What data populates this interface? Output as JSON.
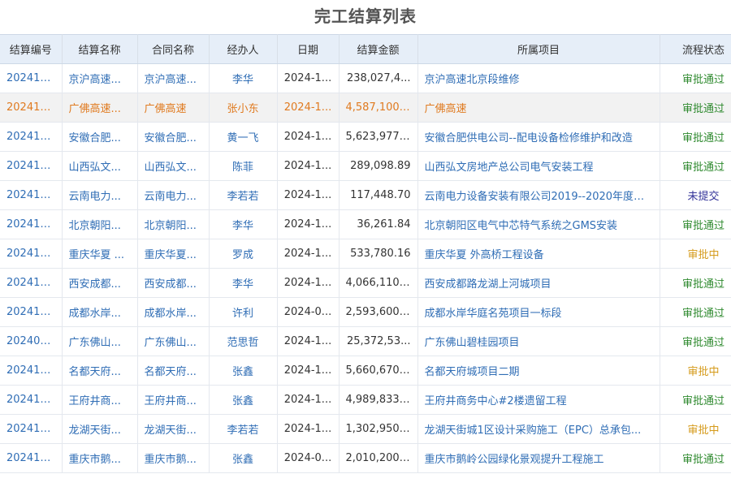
{
  "page_title": "完工结算列表",
  "colors": {
    "header_bg": "#e6eef8",
    "link": "#2f6db5",
    "selected_row_text": "#e07a1f",
    "status_approved": "#2f8a2f",
    "status_pending": "#d59a1a",
    "status_draft": "#333399"
  },
  "columns": [
    "结算编号",
    "结算名称",
    "合同名称",
    "经办人",
    "日期",
    "结算金额",
    "所属项目",
    "流程状态"
  ],
  "rows": [
    {
      "code": "202412...",
      "name": "京沪高速...",
      "contract": "京沪高速...",
      "handler": "李华",
      "date": "2024-1...",
      "amount": "238,027,4...",
      "project": "京沪高速北京段维修",
      "status": "审批通过",
      "status_type": "approved",
      "selected": false
    },
    {
      "code": "202412...",
      "name": "广佛高速...",
      "contract": "广佛高速",
      "handler": "张小东",
      "date": "2024-1...",
      "amount": "4,587,100.00",
      "project": "广佛高速",
      "status": "审批通过",
      "status_type": "approved",
      "selected": true
    },
    {
      "code": "202411...",
      "name": "安徽合肥...",
      "contract": "安徽合肥...",
      "handler": "黄一飞",
      "date": "2024-1...",
      "amount": "5,623,977.00",
      "project": "安徽合肥供电公司--配电设备检修维护和改造",
      "status": "审批通过",
      "status_type": "approved",
      "selected": false
    },
    {
      "code": "202412...",
      "name": "山西弘文...",
      "contract": "山西弘文...",
      "handler": "陈菲",
      "date": "2024-1...",
      "amount": "289,098.89",
      "project": "山西弘文房地产总公司电气安装工程",
      "status": "审批通过",
      "status_type": "approved",
      "selected": false
    },
    {
      "code": "202411...",
      "name": "云南电力...",
      "contract": "云南电力...",
      "handler": "李若若",
      "date": "2024-1...",
      "amount": "117,448.70",
      "project": "云南电力设备安装有限公司2019--2020年度劳...",
      "status": "未提交",
      "status_type": "draft",
      "selected": false
    },
    {
      "code": "202411...",
      "name": "北京朝阳...",
      "contract": "北京朝阳...",
      "handler": "李华",
      "date": "2024-1...",
      "amount": "36,261.84",
      "project": "北京朝阳区电气中芯特气系统之GMS安装",
      "status": "审批通过",
      "status_type": "approved",
      "selected": false
    },
    {
      "code": "202411...",
      "name": "重庆华夏 ...",
      "contract": "重庆华夏...",
      "handler": "罗成",
      "date": "2024-1...",
      "amount": "533,780.16",
      "project": "重庆华夏 外高桥工程设备",
      "status": "审批中",
      "status_type": "pending",
      "selected": false
    },
    {
      "code": "202410...",
      "name": "西安成都...",
      "contract": "西安成都...",
      "handler": "李华",
      "date": "2024-1...",
      "amount": "4,066,110.00",
      "project": "西安成都路龙湖上河城项目",
      "status": "审批通过",
      "status_type": "approved",
      "selected": false
    },
    {
      "code": "202410...",
      "name": "成都水岸...",
      "contract": "成都水岸...",
      "handler": "许利",
      "date": "2024-0...",
      "amount": "2,593,600.00",
      "project": "成都水岸华庭名苑项目一标段",
      "status": "审批通过",
      "status_type": "approved",
      "selected": false
    },
    {
      "code": "202409...",
      "name": "广东佛山...",
      "contract": "广东佛山...",
      "handler": "范思哲",
      "date": "2024-1...",
      "amount": "25,372,53...",
      "project": "广东佛山碧桂园项目",
      "status": "审批通过",
      "status_type": "approved",
      "selected": false
    },
    {
      "code": "202411...",
      "name": "名都天府...",
      "contract": "名都天府...",
      "handler": "张鑫",
      "date": "2024-1...",
      "amount": "5,660,670.00",
      "project": "名都天府城项目二期",
      "status": "审批中",
      "status_type": "pending",
      "selected": false
    },
    {
      "code": "202410...",
      "name": "王府井商...",
      "contract": "王府井商...",
      "handler": "张鑫",
      "date": "2024-1...",
      "amount": "4,989,833.00",
      "project": "王府井商务中心#2楼遗留工程",
      "status": "审批通过",
      "status_type": "approved",
      "selected": false
    },
    {
      "code": "202410...",
      "name": "龙湖天街...",
      "contract": "龙湖天街...",
      "handler": "李若若",
      "date": "2024-1...",
      "amount": "1,302,950.00",
      "project": "龙湖天街城1区设计采购施工（EPC）总承包...",
      "status": "审批中",
      "status_type": "pending",
      "selected": false
    },
    {
      "code": "202410...",
      "name": "重庆市鹅...",
      "contract": "重庆市鹅...",
      "handler": "张鑫",
      "date": "2024-0...",
      "amount": "2,010,200.00",
      "project": "重庆市鹅岭公园绿化景观提升工程施工",
      "status": "审批通过",
      "status_type": "approved",
      "selected": false
    }
  ]
}
